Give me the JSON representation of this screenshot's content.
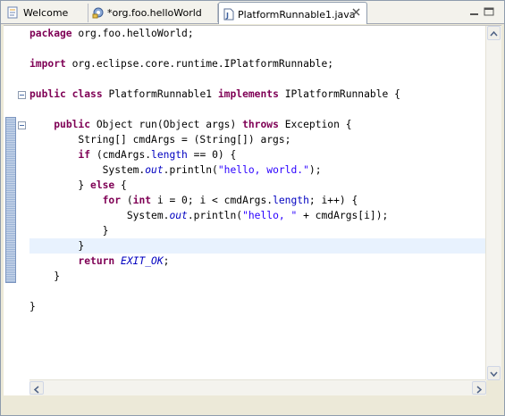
{
  "tabs": [
    {
      "label": "Welcome",
      "icon": "welcome-icon",
      "active": false
    },
    {
      "label": "*org.foo.helloWorld",
      "icon": "plugin-manifest-icon",
      "active": false
    },
    {
      "label": "PlatformRunnable1.java",
      "icon": "java-file-icon",
      "active": true
    }
  ],
  "editor": {
    "current_line": 14,
    "lines": [
      [
        {
          "t": "package",
          "c": "kw"
        },
        {
          "t": " org.foo.helloWorld;"
        }
      ],
      [],
      [
        {
          "t": "import",
          "c": "kw"
        },
        {
          "t": " org.eclipse.core.runtime.IPlatformRunnable;"
        }
      ],
      [],
      [
        {
          "t": "public",
          "c": "kw"
        },
        {
          "t": " "
        },
        {
          "t": "class",
          "c": "kw"
        },
        {
          "t": " PlatformRunnable1 "
        },
        {
          "t": "implements",
          "c": "kw"
        },
        {
          "t": " IPlatformRunnable {"
        }
      ],
      [],
      [
        {
          "t": "    "
        },
        {
          "t": "public",
          "c": "kw"
        },
        {
          "t": " Object run(Object args) "
        },
        {
          "t": "throws",
          "c": "kw"
        },
        {
          "t": " Exception {"
        }
      ],
      [
        {
          "t": "        String[] cmdArgs = (String[]) args;"
        }
      ],
      [
        {
          "t": "        "
        },
        {
          "t": "if",
          "c": "kw"
        },
        {
          "t": " (cmdArgs."
        },
        {
          "t": "length",
          "c": "fld"
        },
        {
          "t": " == 0) {"
        }
      ],
      [
        {
          "t": "            System."
        },
        {
          "t": "out",
          "c": "sfld"
        },
        {
          "t": ".println("
        },
        {
          "t": "\"hello, world.\"",
          "c": "str"
        },
        {
          "t": ");"
        }
      ],
      [
        {
          "t": "        } "
        },
        {
          "t": "else",
          "c": "kw"
        },
        {
          "t": " {"
        }
      ],
      [
        {
          "t": "            "
        },
        {
          "t": "for",
          "c": "kw"
        },
        {
          "t": " ("
        },
        {
          "t": "int",
          "c": "kw"
        },
        {
          "t": " i = 0; i < cmdArgs."
        },
        {
          "t": "length",
          "c": "fld"
        },
        {
          "t": "; i++) {"
        }
      ],
      [
        {
          "t": "                System."
        },
        {
          "t": "out",
          "c": "sfld"
        },
        {
          "t": ".println("
        },
        {
          "t": "\"hello, \"",
          "c": "str"
        },
        {
          "t": " + cmdArgs[i]);"
        }
      ],
      [
        {
          "t": "            }"
        }
      ],
      [
        {
          "t": "        }"
        }
      ],
      [
        {
          "t": "        "
        },
        {
          "t": "return",
          "c": "kw"
        },
        {
          "t": " "
        },
        {
          "t": "EXIT_OK",
          "c": "sfld"
        },
        {
          "t": ";"
        }
      ],
      [
        {
          "t": "    }"
        }
      ],
      [],
      [
        {
          "t": "}"
        }
      ]
    ]
  }
}
